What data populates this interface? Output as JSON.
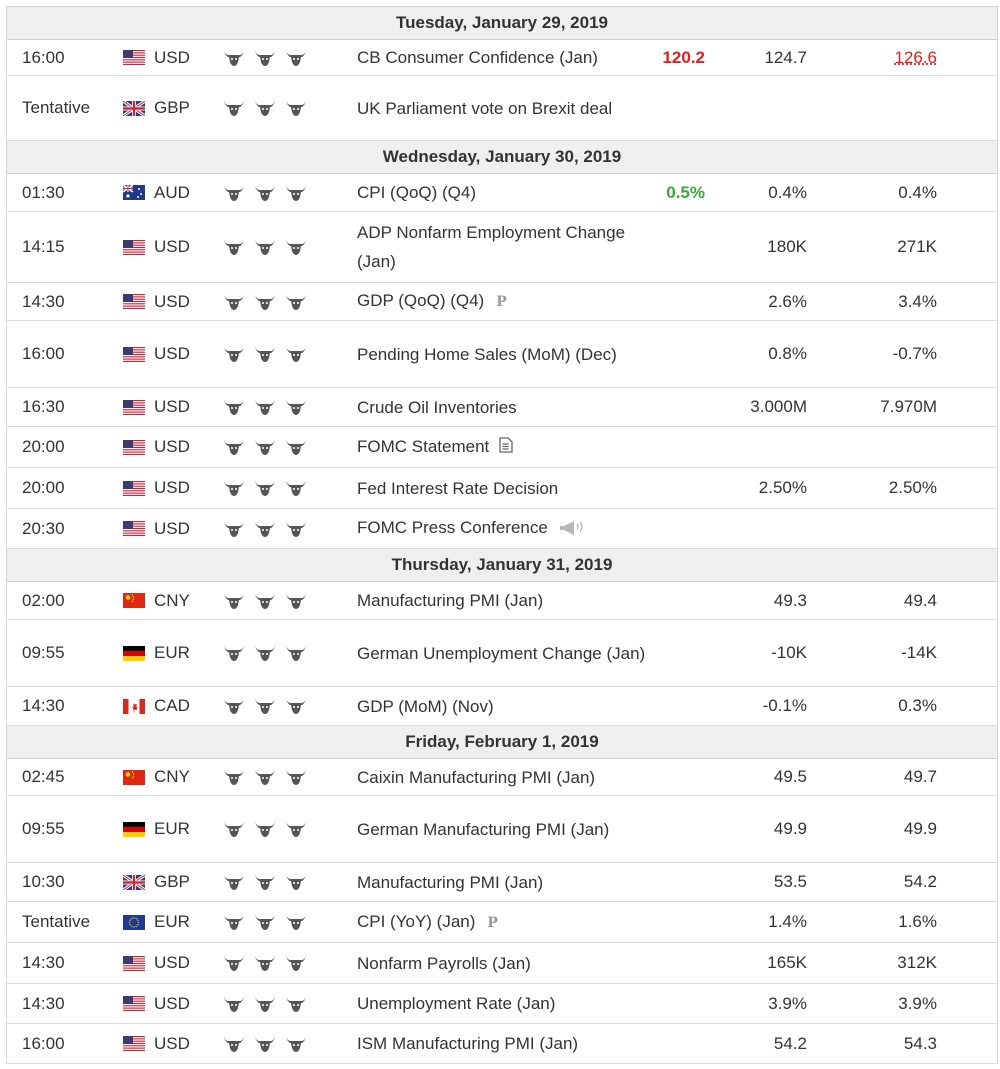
{
  "columns": [
    "time",
    "currency",
    "importance",
    "event",
    "actual",
    "forecast",
    "previous"
  ],
  "colors": {
    "actual_worse": "#e02020",
    "actual_better": "#3aa83a",
    "day_header_bg": "#efefef"
  },
  "days": [
    {
      "label": "Tuesday, January 29, 2019",
      "events": [
        {
          "time": "16:00",
          "flag": "us",
          "currency": "USD",
          "importance": 3,
          "event": "CB Consumer Confidence (Jan)",
          "event_icon": "",
          "actual": "120.2",
          "actual_state": "worse",
          "forecast": "124.7",
          "previous": "126.6",
          "previous_revised": true,
          "height": 35
        },
        {
          "time": "Tentative",
          "flag": "gb",
          "currency": "GBP",
          "importance": 3,
          "event": "UK Parliament vote on Brexit deal",
          "event_icon": "",
          "actual": "",
          "actual_state": "",
          "forecast": "",
          "previous": "",
          "previous_revised": false,
          "height": 64
        }
      ]
    },
    {
      "label": "Wednesday, January 30, 2019",
      "events": [
        {
          "time": "01:30",
          "flag": "au",
          "currency": "AUD",
          "importance": 3,
          "event": "CPI (QoQ) (Q4)",
          "event_icon": "",
          "actual": "0.5%",
          "actual_state": "better",
          "forecast": "0.4%",
          "previous": "0.4%",
          "previous_revised": false,
          "height": 37
        },
        {
          "time": "14:15",
          "flag": "us",
          "currency": "USD",
          "importance": 3,
          "event": "ADP Nonfarm Employment Change (Jan)",
          "event_icon": "",
          "actual": "",
          "actual_state": "",
          "forecast": "180K",
          "previous": "271K",
          "previous_revised": false,
          "height": 70
        },
        {
          "time": "14:30",
          "flag": "us",
          "currency": "USD",
          "importance": 3,
          "event": "GDP (QoQ) (Q4)",
          "event_icon": "preliminary-icon",
          "actual": "",
          "actual_state": "",
          "forecast": "2.6%",
          "previous": "3.4%",
          "previous_revised": false,
          "height": 37
        },
        {
          "time": "16:00",
          "flag": "us",
          "currency": "USD",
          "importance": 3,
          "event": "Pending Home Sales (MoM) (Dec)",
          "event_icon": "",
          "actual": "",
          "actual_state": "",
          "forecast": "0.8%",
          "previous": "-0.7%",
          "previous_revised": false,
          "height": 66
        },
        {
          "time": "16:30",
          "flag": "us",
          "currency": "USD",
          "importance": 3,
          "event": "Crude Oil Inventories",
          "event_icon": "",
          "actual": "",
          "actual_state": "",
          "forecast": "3.000M",
          "previous": "7.970M",
          "previous_revised": false,
          "height": 38
        },
        {
          "time": "20:00",
          "flag": "us",
          "currency": "USD",
          "importance": 3,
          "event": "FOMC Statement",
          "event_icon": "document-icon",
          "actual": "",
          "actual_state": "",
          "forecast": "",
          "previous": "",
          "previous_revised": false,
          "height": 40
        },
        {
          "time": "20:00",
          "flag": "us",
          "currency": "USD",
          "importance": 3,
          "event": "Fed Interest Rate Decision",
          "event_icon": "",
          "actual": "",
          "actual_state": "",
          "forecast": "2.50%",
          "previous": "2.50%",
          "previous_revised": false,
          "height": 40
        },
        {
          "time": "20:30",
          "flag": "us",
          "currency": "USD",
          "importance": 3,
          "event": "FOMC Press Conference",
          "event_icon": "speech-icon",
          "actual": "",
          "actual_state": "",
          "forecast": "",
          "previous": "",
          "previous_revised": false,
          "height": 39
        }
      ]
    },
    {
      "label": "Thursday, January 31, 2019",
      "events": [
        {
          "time": "02:00",
          "flag": "cn",
          "currency": "CNY",
          "importance": 3,
          "event": "Manufacturing PMI (Jan)",
          "event_icon": "",
          "actual": "",
          "actual_state": "",
          "forecast": "49.3",
          "previous": "49.4",
          "previous_revised": false,
          "height": 37
        },
        {
          "time": "09:55",
          "flag": "de",
          "currency": "EUR",
          "importance": 3,
          "event": "German Unemployment Change (Jan)",
          "event_icon": "",
          "actual": "",
          "actual_state": "",
          "forecast": "-10K",
          "previous": "-14K",
          "previous_revised": false,
          "height": 66
        },
        {
          "time": "14:30",
          "flag": "ca",
          "currency": "CAD",
          "importance": 3,
          "event": "GDP (MoM) (Nov)",
          "event_icon": "",
          "actual": "",
          "actual_state": "",
          "forecast": "-0.1%",
          "previous": "0.3%",
          "previous_revised": false,
          "height": 38
        }
      ]
    },
    {
      "label": "Friday, February 1, 2019",
      "events": [
        {
          "time": "02:45",
          "flag": "cn",
          "currency": "CNY",
          "importance": 3,
          "event": "Caixin Manufacturing PMI (Jan)",
          "event_icon": "",
          "actual": "",
          "actual_state": "",
          "forecast": "49.5",
          "previous": "49.7",
          "previous_revised": false,
          "height": 36
        },
        {
          "time": "09:55",
          "flag": "de",
          "currency": "EUR",
          "importance": 3,
          "event": "German Manufacturing PMI (Jan)",
          "event_icon": "",
          "actual": "",
          "actual_state": "",
          "forecast": "49.9",
          "previous": "49.9",
          "previous_revised": false,
          "height": 66
        },
        {
          "time": "10:30",
          "flag": "gb",
          "currency": "GBP",
          "importance": 3,
          "event": "Manufacturing PMI (Jan)",
          "event_icon": "",
          "actual": "",
          "actual_state": "",
          "forecast": "53.5",
          "previous": "54.2",
          "previous_revised": false,
          "height": 38
        },
        {
          "time": "Tentative",
          "flag": "eu",
          "currency": "EUR",
          "importance": 3,
          "event": "CPI (YoY) (Jan)",
          "event_icon": "preliminary-icon",
          "actual": "",
          "actual_state": "",
          "forecast": "1.4%",
          "previous": "1.6%",
          "previous_revised": false,
          "height": 40
        },
        {
          "time": "14:30",
          "flag": "us",
          "currency": "USD",
          "importance": 3,
          "event": "Nonfarm Payrolls (Jan)",
          "event_icon": "",
          "actual": "",
          "actual_state": "",
          "forecast": "165K",
          "previous": "312K",
          "previous_revised": false,
          "height": 40
        },
        {
          "time": "14:30",
          "flag": "us",
          "currency": "USD",
          "importance": 3,
          "event": "Unemployment Rate (Jan)",
          "event_icon": "",
          "actual": "",
          "actual_state": "",
          "forecast": "3.9%",
          "previous": "3.9%",
          "previous_revised": false,
          "height": 39
        },
        {
          "time": "16:00",
          "flag": "us",
          "currency": "USD",
          "importance": 3,
          "event": "ISM Manufacturing PMI (Jan)",
          "event_icon": "",
          "actual": "",
          "actual_state": "",
          "forecast": "54.2",
          "previous": "54.3",
          "previous_revised": false,
          "height": 39
        }
      ]
    }
  ],
  "preliminary_mark": "P"
}
